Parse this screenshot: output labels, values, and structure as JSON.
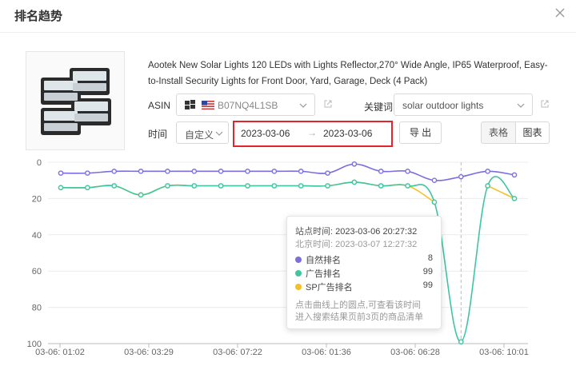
{
  "dialog": {
    "title": "排名趋势"
  },
  "product": {
    "title": "Aootek New Solar Lights 120 LEDs with Lights Reflector,270° Wide Angle, IP65 Waterproof, Easy-to-Install Security Lights for Front Door, Yard, Garage, Deck (4 Pack)"
  },
  "filters": {
    "asin_label": "ASIN",
    "asin_value": "B07NQ4L1SB",
    "keyword_label": "关键词",
    "keyword_value": "solar outdoor lights",
    "time_label": "时间",
    "time_mode": "自定义",
    "date_start": "2023-03-06",
    "date_sep": "→",
    "date_end": "2023-03-06",
    "export_label": "导 出",
    "view_table": "表格",
    "view_chart": "图表"
  },
  "tooltip": {
    "site_time_label": "站点时间:",
    "site_time": "2023-03-06 20:27:32",
    "beijing_time_label": "北京时间:",
    "beijing_time": "2023-03-07 12:27:32",
    "rows": [
      {
        "name": "自然排名",
        "value": "8",
        "color": "#7b6fe0"
      },
      {
        "name": "广告排名",
        "value": "99",
        "color": "#3dc6a0"
      },
      {
        "name": "SP广告排名",
        "value": "99",
        "color": "#f6c022"
      }
    ],
    "hint1": "点击曲线上的圆点,可查看该时间",
    "hint2": "进入搜索结果页前3页的商品清单"
  },
  "chart_data": {
    "type": "line",
    "y_inverted": true,
    "ylim": [
      0,
      100
    ],
    "y_ticks": [
      0,
      20,
      40,
      60,
      80,
      100
    ],
    "x_tick_labels": [
      "03-06: 01:02",
      "03-06: 03:29",
      "03-06: 07:22",
      "03-06: 01:36",
      "03-06: 06:28",
      "03-06: 10:01"
    ],
    "series": [
      {
        "name": "自然排名",
        "color": "#7b6fe0",
        "values": [
          6,
          6,
          5,
          5,
          5,
          5,
          5,
          5,
          5,
          5,
          6,
          1,
          5,
          5,
          10,
          8,
          5,
          7
        ]
      },
      {
        "name": "广告排名",
        "color": "#3dc6a0",
        "values": [
          14,
          14,
          13,
          18,
          13,
          13,
          13,
          13,
          13,
          13,
          13,
          11,
          13,
          13,
          22,
          99,
          13,
          20
        ]
      },
      {
        "name": "SP广告排名",
        "color": "#f6c022",
        "values": [
          14,
          14,
          13,
          18,
          13,
          13,
          13,
          13,
          13,
          13,
          13,
          11,
          13,
          13,
          22,
          null,
          13,
          20
        ]
      }
    ],
    "highlight_index": 15
  }
}
